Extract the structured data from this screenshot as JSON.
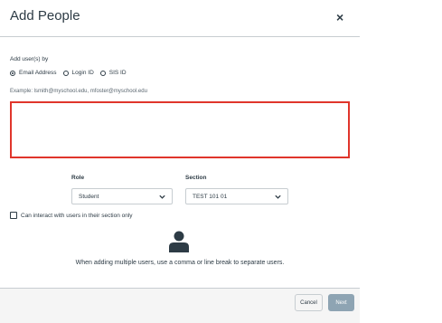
{
  "dialog": {
    "title": "Add People",
    "close_symbol": "×"
  },
  "add_by": {
    "label": "Add user(s) by",
    "options": [
      {
        "label": "Email Address",
        "checked": true
      },
      {
        "label": "Login ID",
        "checked": false
      },
      {
        "label": "SIS ID",
        "checked": false
      }
    ]
  },
  "users_input": {
    "example": "Example: lsmith@myschool.edu, mfoster@myschool.edu",
    "value": "",
    "border_color": "#e0352b"
  },
  "role": {
    "label": "Role",
    "selected": "Student"
  },
  "section": {
    "label": "Section",
    "selected": "TEST 101 01"
  },
  "limit_checkbox": {
    "label": "Can interact with users in their section only",
    "checked": false
  },
  "hint": {
    "icon": "user-icon",
    "text": "When adding multiple users, use a comma or line break to separate users."
  },
  "footer": {
    "cancel_label": "Cancel",
    "next_label": "Next"
  },
  "colors": {
    "text": "#2d3b45",
    "error": "#e0352b",
    "next_button_disabled": "#8ea4b3"
  }
}
